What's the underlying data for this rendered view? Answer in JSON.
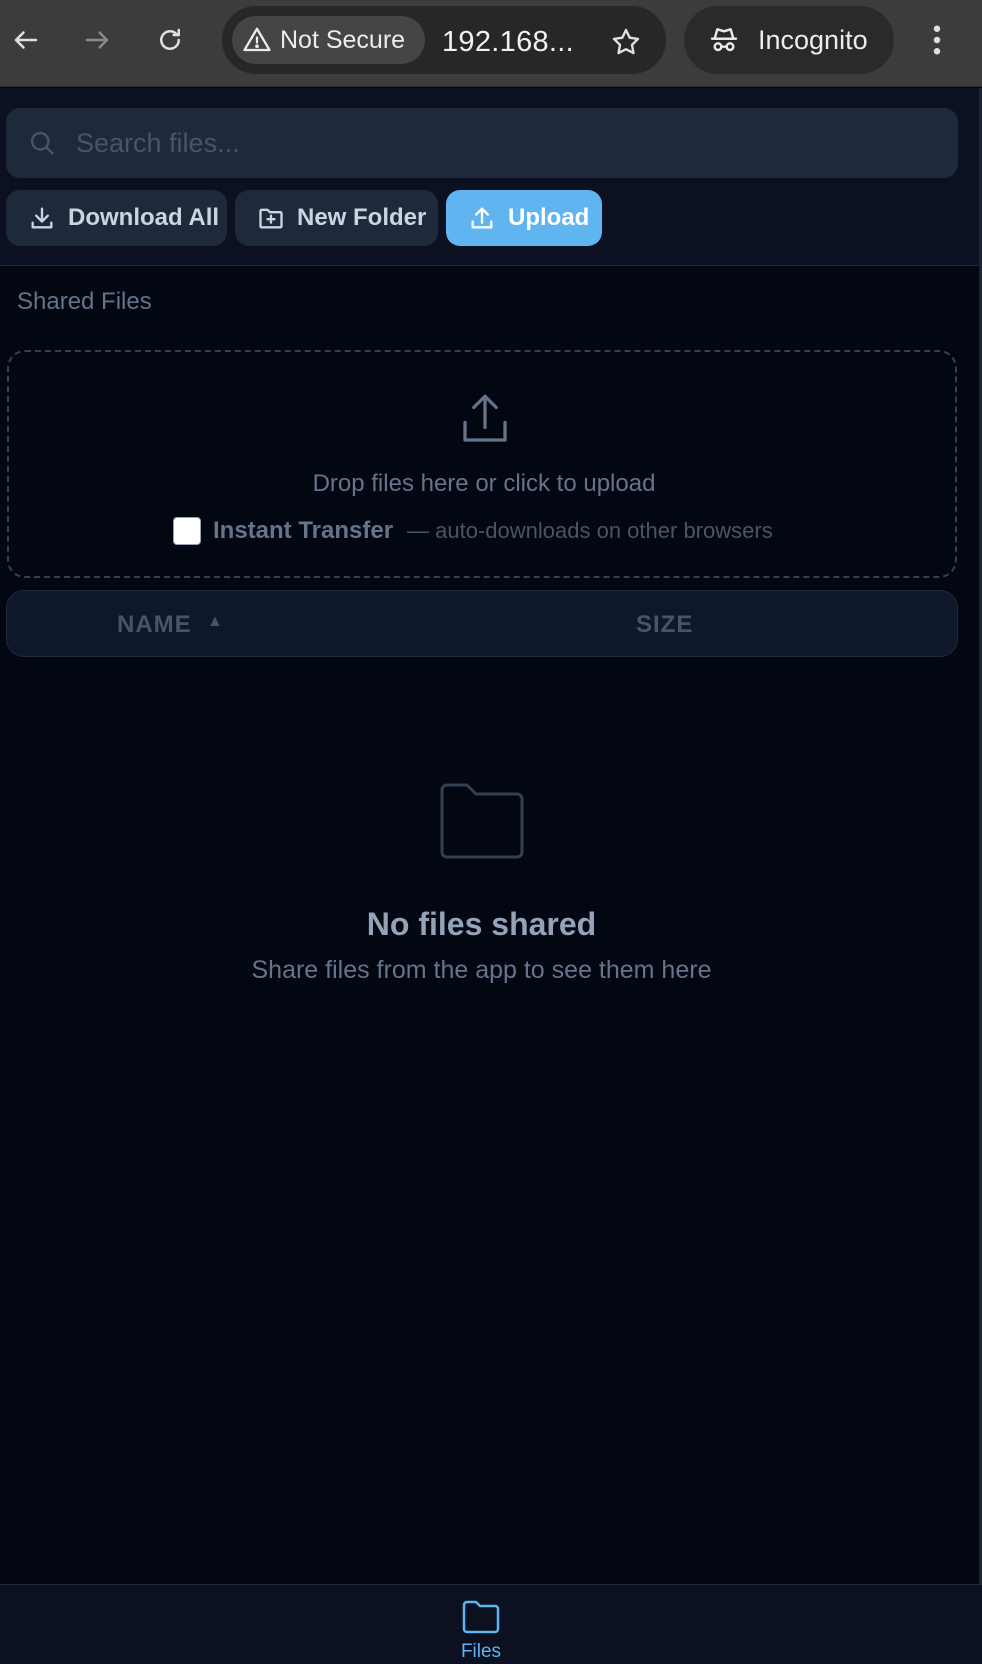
{
  "browser": {
    "security_label": "Not Secure",
    "url": "192.168...",
    "profile_label": "Incognito"
  },
  "toolbar": {
    "search_placeholder": "Search files...",
    "download_all_label": "Download All",
    "new_folder_label": "New Folder",
    "upload_label": "Upload"
  },
  "content": {
    "section_title": "Shared Files",
    "dropzone_text": "Drop files here or click to upload",
    "instant_transfer_label": "Instant Transfer",
    "instant_transfer_hint": "— auto-downloads on other browsers",
    "instant_transfer_checked": false,
    "table": {
      "columns": [
        {
          "label": "NAME",
          "sort": "ascending"
        },
        {
          "label": "SIZE"
        }
      ],
      "sort_indicator": "▲",
      "rows": []
    },
    "empty_title": "No files shared",
    "empty_subtitle": "Share files from the app to see them here"
  },
  "bottom_nav": {
    "items": [
      {
        "label": "Files",
        "icon": "folder-icon",
        "active": true
      }
    ]
  },
  "colors": {
    "accent": "#60b4f0",
    "background": "#030712",
    "surface": "#1e293b"
  }
}
